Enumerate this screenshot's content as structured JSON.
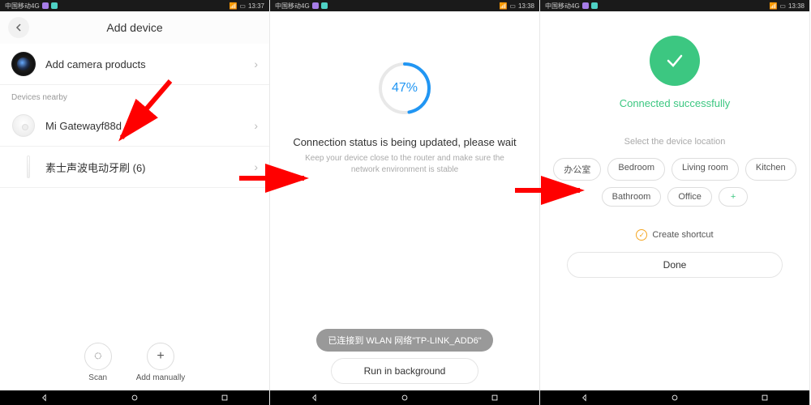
{
  "statusbar": {
    "carrier": "中国移动4G",
    "time1": "13:37",
    "time2": "13:38",
    "time3": "13:38"
  },
  "screen1": {
    "title": "Add device",
    "camera_label": "Add camera products",
    "section": "Devices nearby",
    "device1": "Mi Gatewayf88d",
    "device2": "素士声波电动牙刷 (6)",
    "scan": "Scan",
    "add_manually": "Add manually"
  },
  "screen2": {
    "progress_pct": "47%",
    "progress_value": 47,
    "status_title": "Connection status is being updated, please wait",
    "status_sub": "Keep your device close to the router and make sure the network environment is stable",
    "toast": "已连接到 WLAN 网络\"TP-LINK_ADD6\"",
    "run_bg": "Run in background"
  },
  "screen3": {
    "success": "Connected successfully",
    "loc_label": "Select the device location",
    "chips": [
      "办公室",
      "Bedroom",
      "Living room",
      "Kitchen",
      "Bathroom",
      "Office"
    ],
    "add_chip": "+",
    "shortcut": "Create shortcut",
    "done": "Done"
  }
}
